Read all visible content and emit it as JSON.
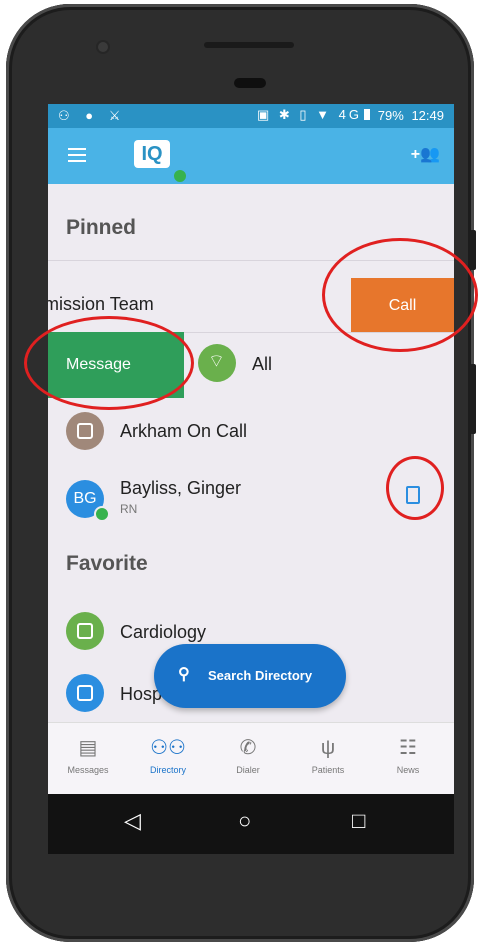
{
  "statusbar": {
    "left_icons": "⚇ ● ⚔",
    "network_icons": "▣ ✱ ▯ ▼ 4G",
    "battery": "79%",
    "time": "12:49"
  },
  "appbar": {
    "logo_text": "IQ",
    "add_contact_icon": "+👥"
  },
  "sections": {
    "pinned": "Pinned",
    "favorite": "Favorite"
  },
  "pinned": [
    {
      "label": "mission Team"
    },
    {
      "label": "All"
    },
    {
      "label": "Arkham On Call"
    },
    {
      "label": "Bayliss, Ginger",
      "initials": "BG",
      "subtitle": "RN"
    }
  ],
  "favorite": [
    {
      "label": "Cardiology"
    },
    {
      "label": "Hosp"
    }
  ],
  "swipe_actions": {
    "call": "Call",
    "message": "Message"
  },
  "fab": {
    "label": "Search Directory"
  },
  "bottom_nav": [
    {
      "label": "Messages",
      "icon": "message-icon"
    },
    {
      "label": "Directory",
      "icon": "people-icon",
      "active": true
    },
    {
      "label": "Dialer",
      "icon": "phone-icon"
    },
    {
      "label": "Patients",
      "icon": "stethoscope-icon"
    },
    {
      "label": "News",
      "icon": "news-icon"
    }
  ],
  "colors": {
    "primary": "#4ab3e6",
    "call": "#e7762c",
    "message": "#2f9e5a",
    "fab": "#1a73c9",
    "highlight_ring": "#e02020"
  }
}
